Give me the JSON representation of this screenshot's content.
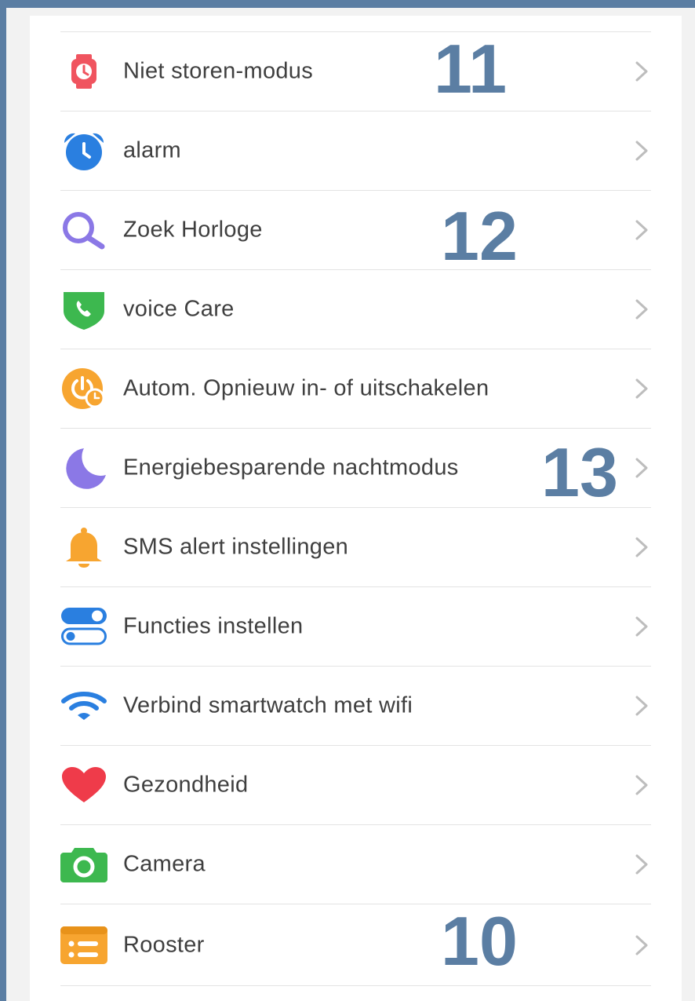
{
  "menu": {
    "items": [
      {
        "label": "Niet storen-modus",
        "icon": "watch-icon"
      },
      {
        "label": "alarm",
        "icon": "alarm-clock-icon"
      },
      {
        "label": "Zoek Horloge",
        "icon": "search-icon"
      },
      {
        "label": "voice Care",
        "icon": "shield-phone-icon"
      },
      {
        "label": "Autom. Opnieuw in- of uitschakelen",
        "icon": "power-clock-icon"
      },
      {
        "label": "Energiebesparende nachtmodus",
        "icon": "moon-icon"
      },
      {
        "label": "SMS alert instellingen",
        "icon": "bell-icon"
      },
      {
        "label": "Functies instellen",
        "icon": "toggle-switches-icon"
      },
      {
        "label": "Verbind smartwatch met wifi",
        "icon": "wifi-icon"
      },
      {
        "label": "Gezondheid",
        "icon": "heart-icon"
      },
      {
        "label": "Camera",
        "icon": "camera-icon"
      },
      {
        "label": "Rooster",
        "icon": "schedule-icon"
      }
    ]
  },
  "annotations": {
    "a11": "11",
    "a12": "12",
    "a13": "13",
    "a10": "10"
  },
  "colors": {
    "annotation": "#5b7ea3",
    "divider": "#e3e3e3",
    "text": "#3f3f3f",
    "chevron": "#bdbdbd"
  }
}
